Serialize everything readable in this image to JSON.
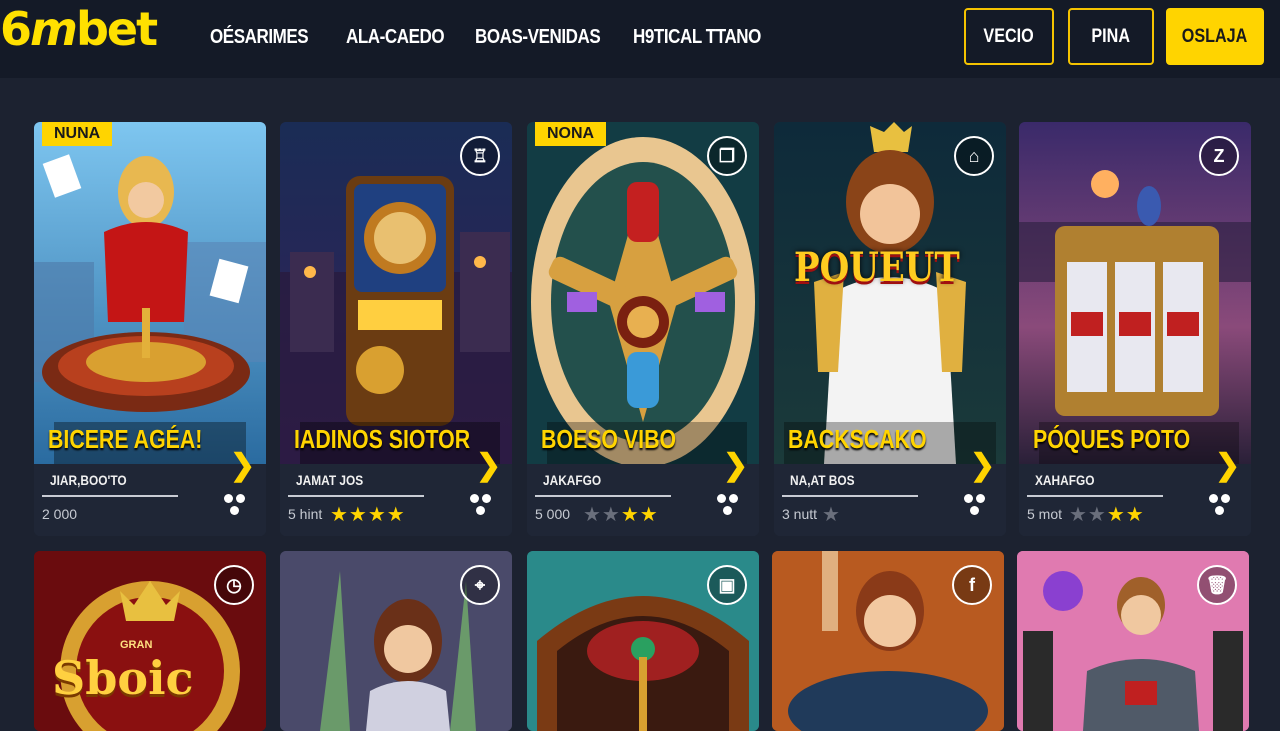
{
  "brand": {
    "logo_a": "6",
    "logo_b": "m",
    "logo_c": "bet"
  },
  "nav": {
    "items": [
      "OÉSARIMES",
      "ALA-CAEDO",
      "BOAS-VENIDAS",
      "H9TICAL TTANO"
    ]
  },
  "header_buttons": {
    "b1": "VECIO",
    "b2": "PINA",
    "b3": "OSLAJA"
  },
  "cards": [
    {
      "badge": "NUNA",
      "title": "BICERE AGÉA!",
      "sub": "JIAR,BOO'TO",
      "meta": "2 000",
      "stars_on": 0,
      "stars_off": 0
    },
    {
      "badge": "",
      "title": "IADINOS SIOTOR",
      "sub": "JAMAT JOS",
      "meta": "5 hint",
      "stars_on": 4,
      "stars_off": 0
    },
    {
      "badge": "NONA",
      "title": "BOESO VIBO",
      "sub": "JAKAFGO",
      "meta": "5 000",
      "stars_on": 2,
      "stars_off": 2
    },
    {
      "badge": "",
      "title": "BACKSCAKO",
      "sub": "NA,AT BOS",
      "meta": "3 nutt",
      "stars_on": 0,
      "stars_off": 1
    },
    {
      "badge": "",
      "title": "PÓQUES POTO",
      "sub": "XAHAFGO",
      "meta": "5 mot",
      "stars_on": 2,
      "stars_off": 2
    }
  ],
  "card_art_text": {
    "poker_logo": "POUEUT",
    "sboic_logo": "Sboic",
    "sboic_small": "GRAN"
  },
  "icons": [
    "roulette-icon",
    "slot-icon",
    "jewel-icon",
    "house-icon",
    "z-icon",
    "clock-icon",
    "timer-icon",
    "slot2-icon",
    "facebook-icon",
    "trash-icon"
  ],
  "colors": {
    "accent": "#ffd400",
    "bg": "#1c2230",
    "topbar": "#141a27"
  }
}
